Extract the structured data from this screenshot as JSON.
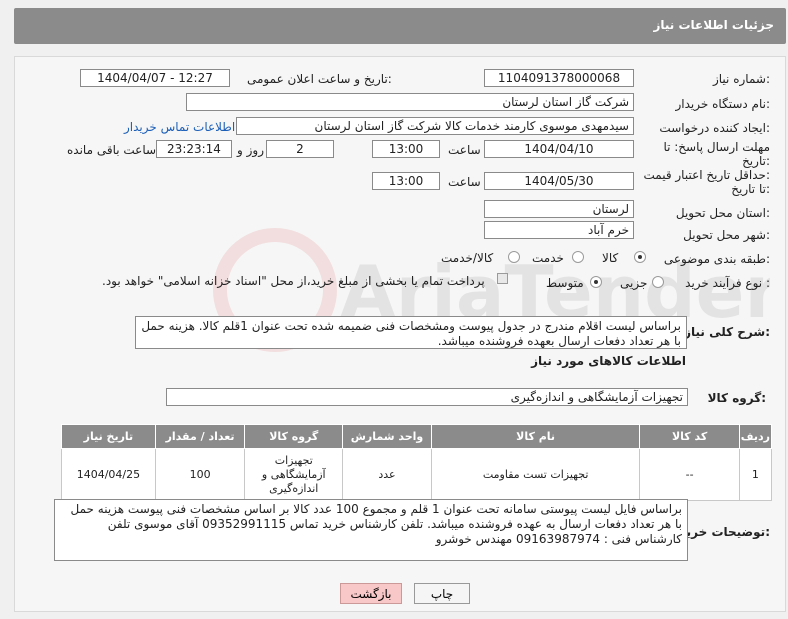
{
  "header": {
    "title": "جزئیات اطلاعات نیاز"
  },
  "fields": {
    "need_number_label": "شماره نیاز:",
    "need_number": "1104091378000068",
    "announce_label": "تاریخ و ساعت اعلان عمومی:",
    "announce_value": "1404/04/07 - 12:27",
    "buyer_org_label": "نام دستگاه خریدار:",
    "buyer_org": "شرکت گاز استان لرستان",
    "requester_label": "ایجاد کننده درخواست:",
    "requester": "سیدمهدی موسوی کارمند خدمات کالا شرکت گاز استان لرستان",
    "buyer_contact_link": "اطلاعات تماس خریدار",
    "reply_deadline_label_1": "مهلت ارسال پاسخ: تا",
    "reply_deadline_label_2": "تاریخ:",
    "reply_date": "1404/04/10",
    "time_label": "ساعت",
    "reply_time": "13:00",
    "days_value": "2",
    "days_label": "روز و",
    "remaining_time": "23:23:14",
    "remaining_label": "ساعت باقی مانده",
    "validity_label_1": "حداقل تاریخ اعتبار قیمت:",
    "validity_label_2": "تا تاریخ:",
    "validity_date": "1404/05/30",
    "validity_time": "13:00",
    "province_label": "استان محل تحویل:",
    "province": "لرستان",
    "city_label": "شهر محل تحویل:",
    "city": "خرم آباد",
    "category_label": "طبقه بندی موضوعی:",
    "category_options": [
      "کالا",
      "خدمت",
      "کالا/خدمت"
    ],
    "process_label": "نوع فرآیند خرید :",
    "process_options": [
      "جزیی",
      "متوسط"
    ],
    "payment_note": "پرداخت تمام یا بخشی از مبلغ خرید،از محل \"اسناد خزانه اسلامی\" خواهد بود.",
    "summary_label": "شرح کلی نیاز:",
    "summary": "براساس لیست اقلام مندرج در جدول پیوست ومشخصات فنی ضمیمه شده تحت عنوان 1قلم کالا. هزینه حمل با هر تعداد دفعات ارسال بعهده فروشنده میباشد."
  },
  "goods": {
    "section_title": "اطلاعات کالاهای مورد نیاز",
    "group_label": "گروه کالا:",
    "group_value": "تجهیزات آزمایشگاهی و اندازه‌گیری",
    "columns": [
      "ردیف",
      "کد کالا",
      "نام کالا",
      "واحد شمارش",
      "گروه کالا",
      "تعداد / مقدار",
      "تاریخ نیاز"
    ],
    "rows": [
      {
        "row": "1",
        "code": "--",
        "name": "تجهیزات تست مقاومت",
        "unit": "عدد",
        "group": "تجهیزات آزمایشگاهی و اندازه‌گیری",
        "qty": "100",
        "date": "1404/04/25"
      }
    ]
  },
  "buyer_notes": {
    "label": "توضیحات خریدار:",
    "text": "براساس  فایل لیست پیوستی سامانه تحت عنوان 1 قلم و مجموع 100 عدد کالا بر اساس مشخصات فنی پیوست هزینه حمل با هر تعداد دفعات ارسال به عهده فروشنده میباشد. تلفن کارشناس خرید تماس 09352991115 آقای موسوی تلفن کارشناس فنی : 09163987974 مهندس خوشرو"
  },
  "buttons": {
    "print": "چاپ",
    "back": "بازگشت"
  },
  "watermark": {
    "text": "AriaTender.neT"
  }
}
